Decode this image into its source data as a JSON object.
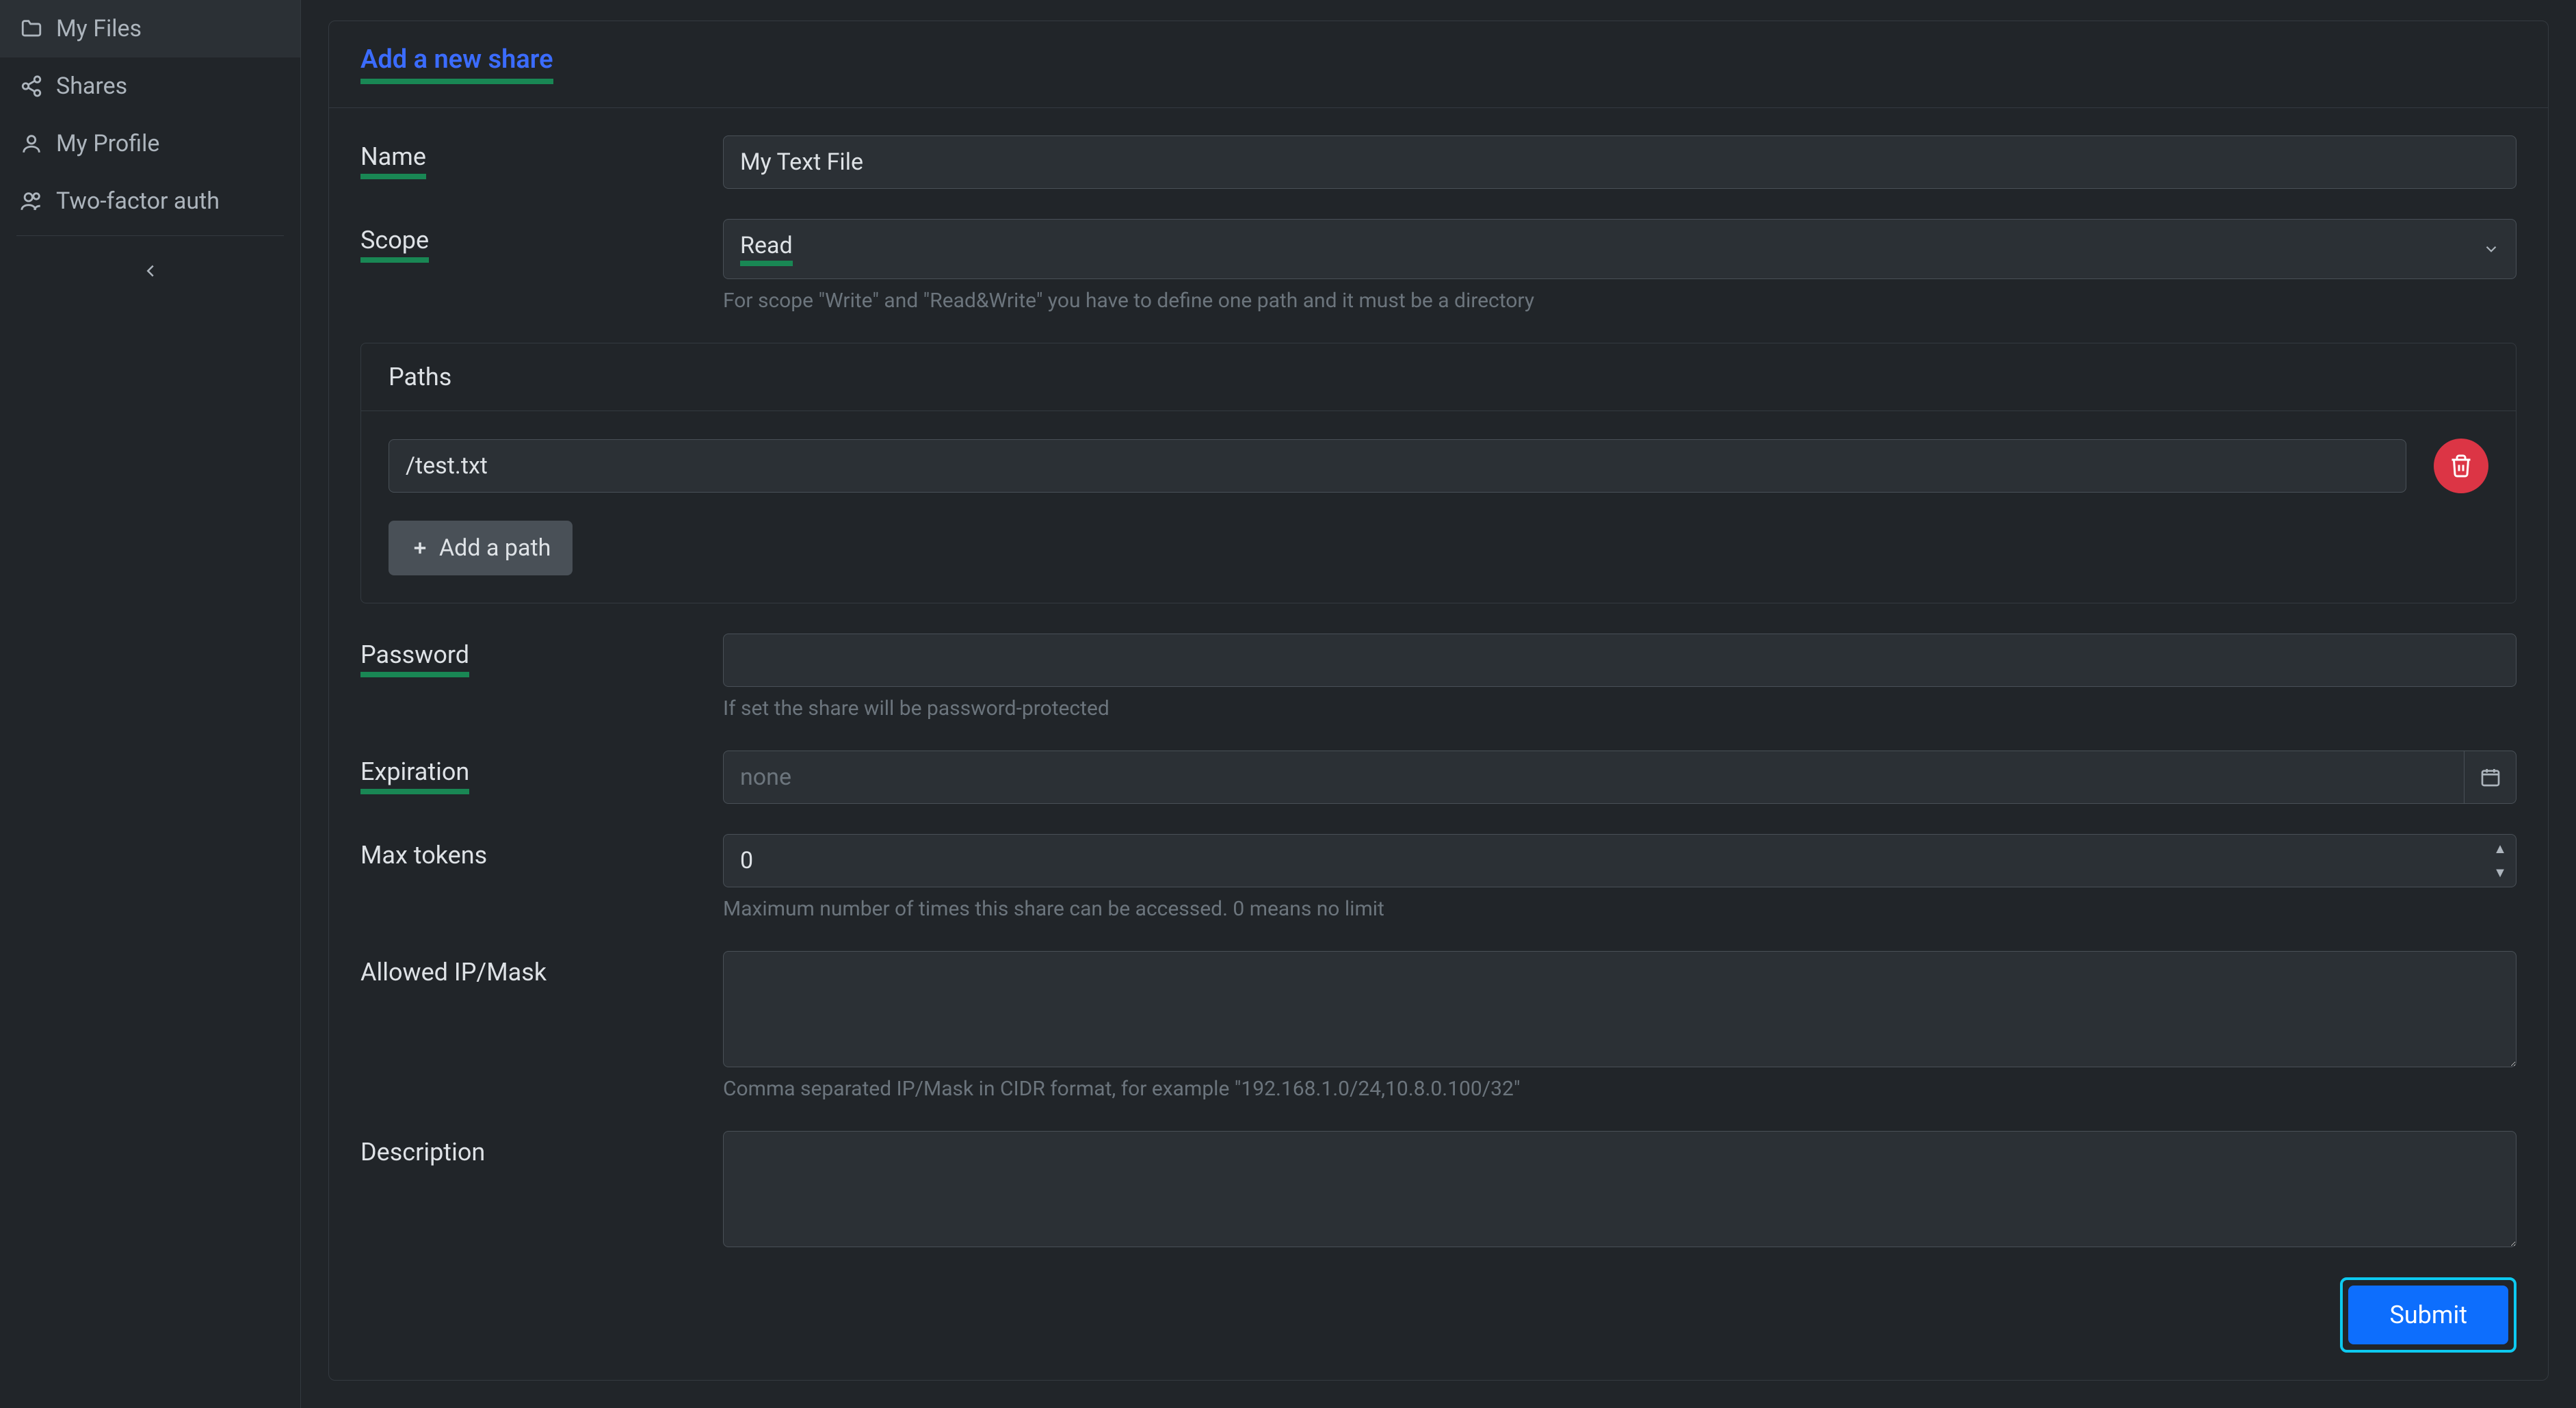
{
  "sidebar": {
    "items": [
      {
        "label": "My Files",
        "icon": "folder-icon"
      },
      {
        "label": "Shares",
        "icon": "share-icon"
      },
      {
        "label": "My Profile",
        "icon": "user-icon"
      },
      {
        "label": "Two-factor auth",
        "icon": "users-icon"
      }
    ]
  },
  "page": {
    "title": "Add a new share"
  },
  "form": {
    "name": {
      "label": "Name",
      "value": "My Text File"
    },
    "scope": {
      "label": "Scope",
      "value": "Read",
      "helper": "For scope \"Write\" and \"Read&Write\" you have to define one path and it must be a directory"
    },
    "paths": {
      "title": "Paths",
      "items": [
        {
          "value": "/test.txt"
        }
      ],
      "add_label": "Add a path"
    },
    "password": {
      "label": "Password",
      "value": "",
      "helper": "If set the share will be password-protected"
    },
    "expiration": {
      "label": "Expiration",
      "placeholder": "none",
      "value": ""
    },
    "max_tokens": {
      "label": "Max tokens",
      "value": "0",
      "helper": "Maximum number of times this share can be accessed. 0 means no limit"
    },
    "allowed_ip": {
      "label": "Allowed IP/Mask",
      "value": "",
      "helper": "Comma separated IP/Mask in CIDR format, for example \"192.168.1.0/24,10.8.0.100/32\""
    },
    "description": {
      "label": "Description",
      "value": ""
    },
    "submit_label": "Submit"
  }
}
